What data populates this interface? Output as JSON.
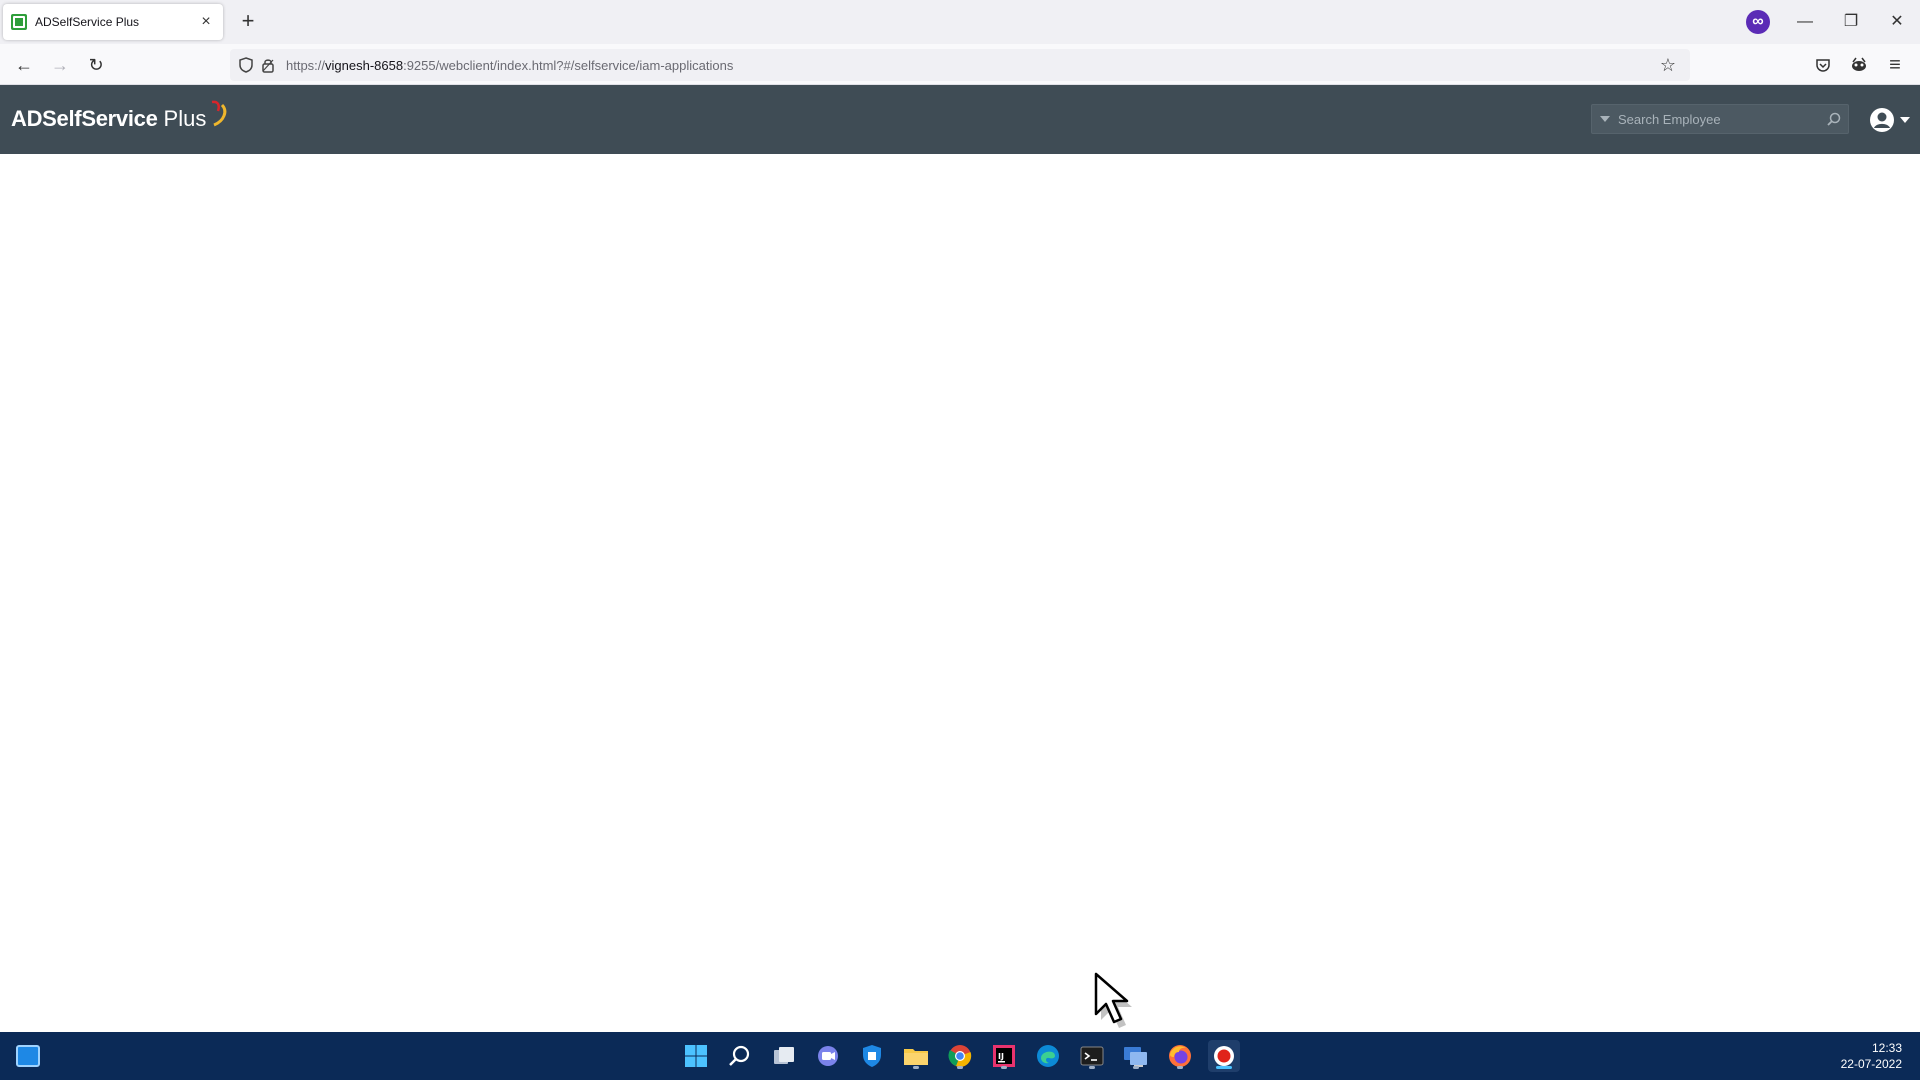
{
  "browser": {
    "tab": {
      "title": "ADSelfService Plus",
      "close": "×"
    },
    "new_tab": "+",
    "window_controls": {
      "minimize": "—",
      "restore": "❐",
      "close": "✕"
    },
    "nav": {
      "back": "←",
      "forward": "→",
      "reload": "↻"
    },
    "url": {
      "prefix": "https://",
      "host": "vignesh-8658",
      "rest": ":9255/webclient/index.html?#/selfservice/iam-applications"
    },
    "bookmark_star": "☆",
    "menu": "≡"
  },
  "app": {
    "logo": {
      "bold": "ADSelfService",
      "light": "Plus"
    },
    "search": {
      "placeholder": "Search Employee"
    }
  },
  "taskbar": {
    "clock": {
      "time": "12:33",
      "date": "22-07-2022"
    },
    "icons": [
      "start",
      "search",
      "task-view",
      "teams-chat",
      "security",
      "file-explorer",
      "chrome",
      "intellij",
      "edge",
      "terminal",
      "remote-desktop",
      "firefox",
      "recorder"
    ]
  },
  "colors": {
    "header_bg": "#3f4c55",
    "taskbar_bg": "#0b2a57",
    "accent_green": "#2e9e3a"
  }
}
